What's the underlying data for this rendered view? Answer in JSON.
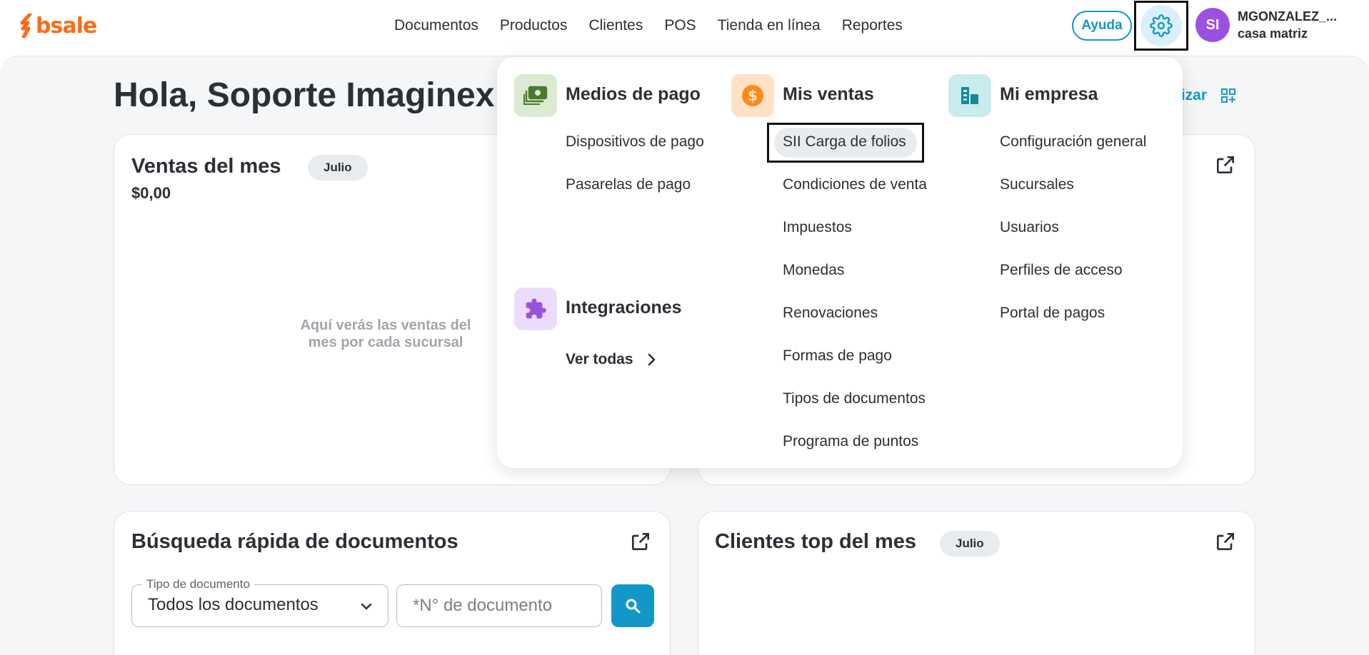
{
  "brand": {
    "logo_text": "bsale",
    "color": "#ff6a13"
  },
  "nav": [
    "Documentos",
    "Productos",
    "Clientes",
    "POS",
    "Tienda en línea",
    "Reportes"
  ],
  "header": {
    "help_label": "Ayuda",
    "avatar_initials": "SI",
    "user_name": "MGONZALEZ_...",
    "branch": "casa matriz"
  },
  "greeting": "Hola, Soporte Imaginex",
  "personalize_label": "lizar",
  "sales_card": {
    "title": "Ventas del mes",
    "month": "Julio",
    "amount": "$0,00",
    "empty_message": "Aquí verás las ventas del mes por cada sucursal"
  },
  "search_card": {
    "title": "Búsqueda rápida de documentos",
    "doc_type_label": "Tipo de documento",
    "doc_type_value": "Todos los documentos",
    "doc_number_placeholder": "*N° de documento"
  },
  "clients_card": {
    "title": "Clientes top del mes",
    "month": "Julio"
  },
  "dropdown": {
    "payment": {
      "title": "Medios de pago",
      "items": [
        "Dispositivos de pago",
        "Pasarelas de pago"
      ]
    },
    "integrations": {
      "title": "Integraciones",
      "see_all": "Ver todas"
    },
    "sales": {
      "title": "Mis ventas",
      "items": [
        "SII Carga de folios",
        "Condiciones de venta",
        "Impuestos",
        "Monedas",
        "Renovaciones",
        "Formas de pago",
        "Tipos de documentos",
        "Programa de puntos"
      ]
    },
    "company": {
      "title": "Mi empresa",
      "items": [
        "Configuración general",
        "Sucursales",
        "Usuarios",
        "Perfiles de acceso",
        "Portal de pagos"
      ]
    }
  },
  "colors": {
    "accent": "#1397c9",
    "avatar": "#9b51e0"
  }
}
